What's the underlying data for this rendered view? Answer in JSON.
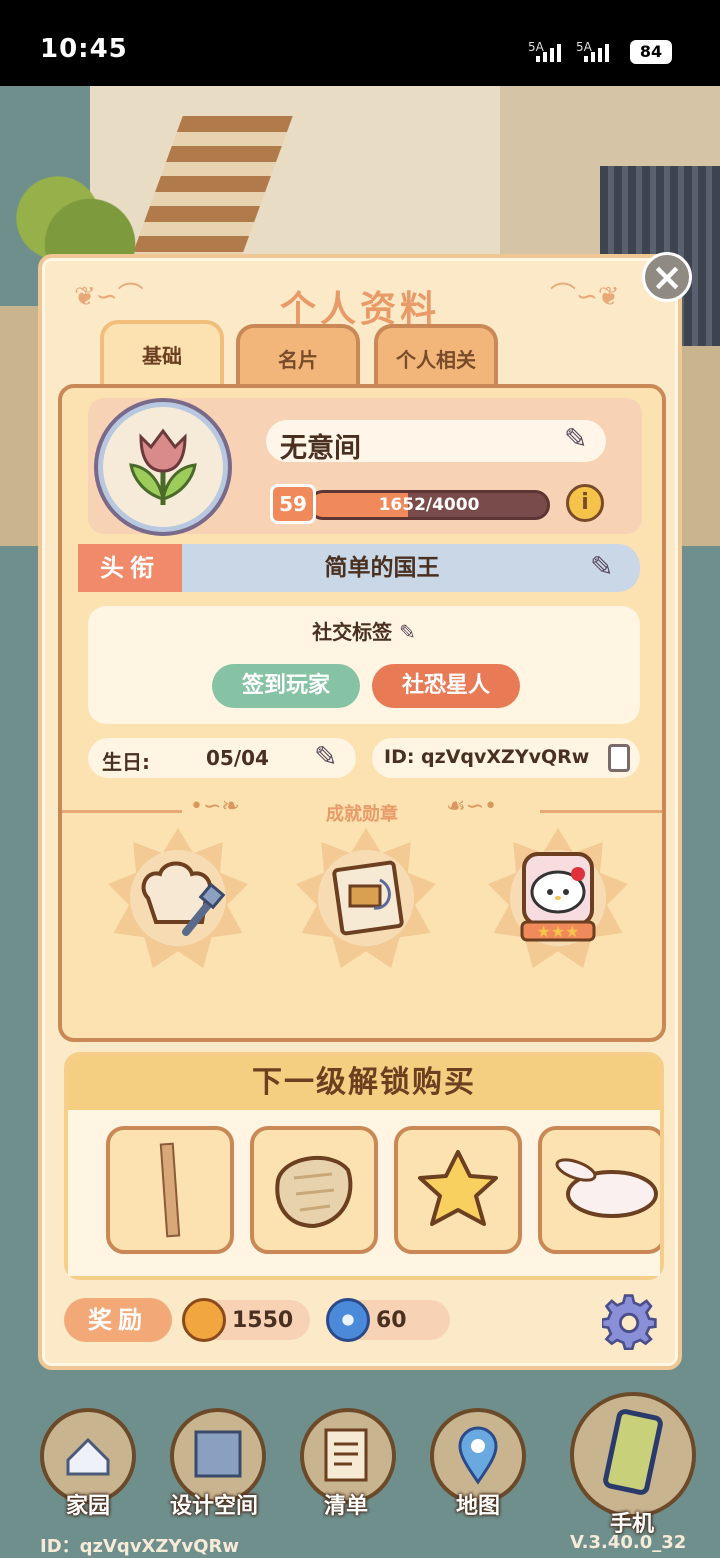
{
  "status": {
    "time": "10:45",
    "sim1": "5A",
    "sim2": "5A",
    "battery": "84"
  },
  "modal": {
    "title": "个人资料",
    "close_icon": "close-icon",
    "tabs": [
      "基础",
      "名片",
      "个人相关"
    ],
    "active_tab": "基础"
  },
  "profile": {
    "name": "无意间",
    "level": "59",
    "xp_text": "1652/4000",
    "xp_current": 1652,
    "xp_max": 4000
  },
  "title_row": {
    "label": "头衔",
    "value": "简单的国王"
  },
  "social_tags": {
    "title": "社交标签",
    "tags": [
      "签到玩家",
      "社恐星人"
    ]
  },
  "birthday": {
    "label": "生日:",
    "value": "05/04"
  },
  "player_id": "ID: qzVqvXZYvQRw",
  "achievements": {
    "title": "成就勋章",
    "medals": [
      "chef-medal-icon",
      "scroll-medal-icon",
      "hello-kitty-medal-icon"
    ]
  },
  "unlock": {
    "title": "下一级解锁购买",
    "items": [
      "wood-plank-icon",
      "cushion-icon",
      "star-pillow-icon",
      "bunny-plush-icon"
    ]
  },
  "rewards": {
    "label": "奖励",
    "coins": "1550",
    "gems": "60"
  },
  "bottom_nav": {
    "items": [
      "家园",
      "设计空间",
      "清单",
      "地图",
      "手机"
    ]
  },
  "footer": {
    "id": "ID：qzVqvXZYvQRw",
    "version": "V.3.40.0_32"
  },
  "colors": {
    "accent": "#f08a5a",
    "panel": "#fbe2b0",
    "border": "#c98855"
  }
}
